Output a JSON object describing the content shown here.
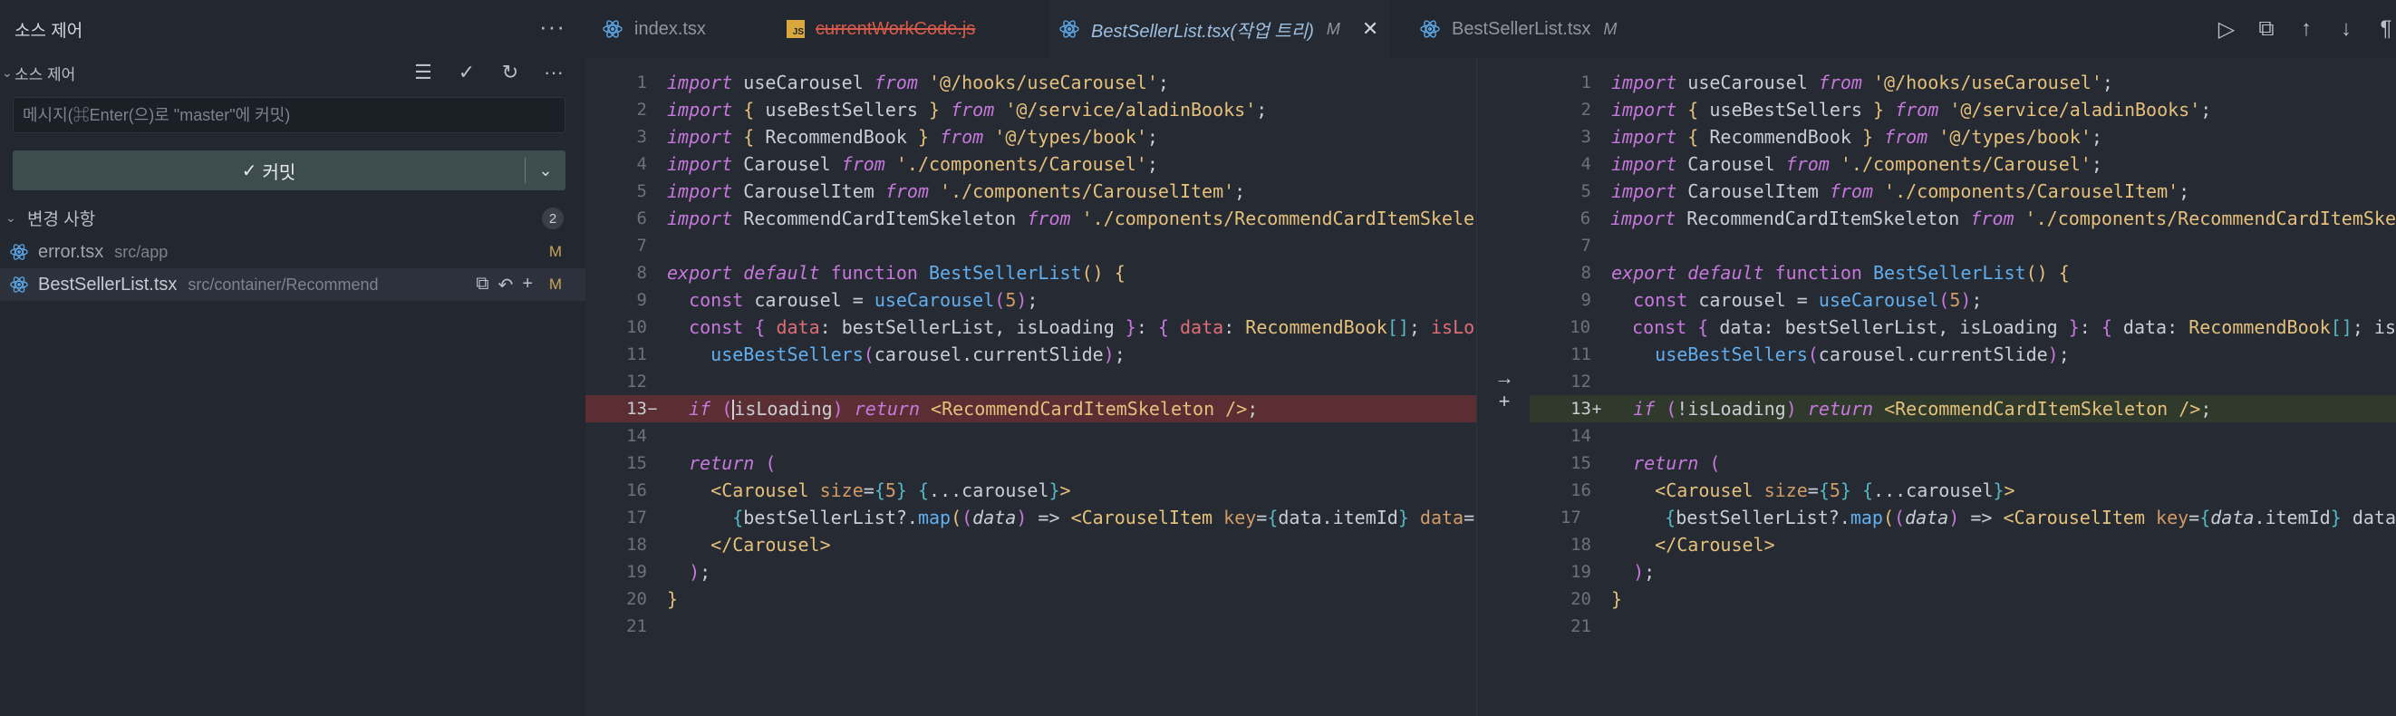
{
  "sidebar": {
    "title": "소스 제어",
    "section_label": "소스 제어",
    "commit_placeholder": "메시지(⌘Enter(으)로 \"master\"에 커밋)",
    "commit_button_label": "커밋",
    "changes_label": "변경 사항",
    "changes_count": "2",
    "files": [
      {
        "name": "error.tsx",
        "path": "src/app",
        "status": "M"
      },
      {
        "name": "BestSellerList.tsx",
        "path": "src/container/Recommend",
        "status": "M"
      }
    ]
  },
  "tabs": [
    {
      "label": "index.tsx",
      "icon": "react-icon"
    },
    {
      "label": "currentWorkCode.js",
      "icon": "js-icon"
    },
    {
      "label": "BestSellerList.tsx(작업 트리)",
      "modifier": "M",
      "icon": "react-icon"
    },
    {
      "label": "BestSellerList.tsx",
      "modifier": "M",
      "icon": "react-icon"
    }
  ],
  "diff": {
    "line_numbers": [
      "1",
      "2",
      "3",
      "4",
      "5",
      "6",
      "7",
      "8",
      "9",
      "10",
      "11",
      "12",
      "13",
      "14",
      "15",
      "16",
      "17",
      "18",
      "19",
      "20",
      "21"
    ],
    "left_markers": {
      "13": "−"
    },
    "right_markers": {
      "13": "+"
    },
    "left_line_13_text": "isLoading",
    "right_line_13_text": "isLoading"
  },
  "colors": {
    "deleted_line": "#5a2e33",
    "added_line": "#2f3a2c",
    "keyword": "#c678dd",
    "string": "#e5c07b",
    "function": "#61afef"
  }
}
